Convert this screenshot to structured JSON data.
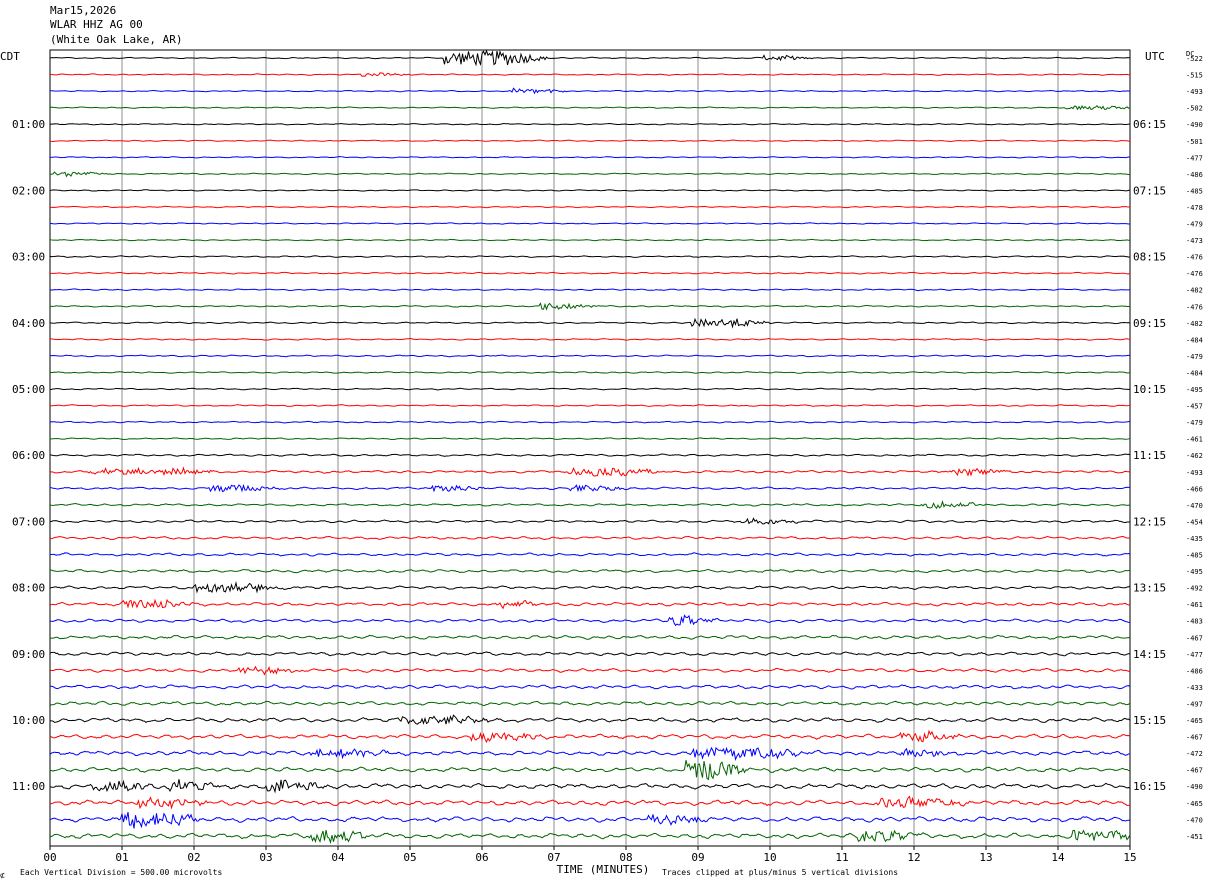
{
  "header": {
    "date": "Mar15,2026",
    "station": "WLAR HHZ AG 00",
    "location": "(White Oak Lake, AR)"
  },
  "left_timezone": "CDT",
  "right_timezone": "UTC",
  "dc_label": "DC",
  "footer": {
    "left_glyph": "⊄",
    "scale_note": "Each Vertical Division =  500.00 microvolts",
    "clip_note": "Traces clipped at plus/minus 5 vertical divisions"
  },
  "chart_data": {
    "type": "line",
    "title": "",
    "xlabel": "TIME (MINUTES)",
    "ylabel": "",
    "xlim": [
      0,
      15
    ],
    "x_ticks": [
      "00",
      "01",
      "02",
      "03",
      "04",
      "05",
      "06",
      "07",
      "08",
      "09",
      "10",
      "11",
      "12",
      "13",
      "14",
      "15"
    ],
    "grid": true,
    "series_colors": [
      "#000000",
      "#ff0000",
      "#0000ff",
      "#006400"
    ],
    "left_hour_labels": [
      "01:00",
      "02:00",
      "03:00",
      "04:00",
      "05:00",
      "06:00",
      "07:00",
      "08:00",
      "09:00",
      "10:00",
      "11:00"
    ],
    "right_hour_labels": [
      "06:15",
      "07:15",
      "08:15",
      "09:15",
      "10:15",
      "11:15",
      "12:15",
      "13:15",
      "14:15",
      "15:15",
      "16:15"
    ],
    "dc_offsets": [
      -522,
      -515,
      -493,
      -502,
      -490,
      -501,
      -477,
      -486,
      -485,
      -478,
      -479,
      -473,
      -476,
      -476,
      -482,
      -476,
      -482,
      -484,
      -479,
      -484,
      -495,
      -457,
      -479,
      -461,
      -462,
      -493,
      -466,
      -470,
      -454,
      -435,
      -485,
      -495,
      -492,
      -461,
      -483,
      -467,
      -477,
      -486,
      -433,
      -497,
      -465,
      -467,
      -472,
      -467,
      -490,
      -465,
      -470,
      -451
    ],
    "trace_count": 48,
    "minutes_per_trace": 15,
    "noise_level": [
      0.25,
      0.25,
      0.25,
      0.25,
      0.25,
      0.25,
      0.25,
      0.25,
      0.25,
      0.25,
      0.25,
      0.25,
      0.3,
      0.3,
      0.3,
      0.3,
      0.3,
      0.3,
      0.3,
      0.3,
      0.3,
      0.3,
      0.3,
      0.3,
      0.4,
      0.5,
      0.45,
      0.45,
      0.5,
      0.55,
      0.55,
      0.6,
      0.6,
      0.65,
      0.65,
      0.7,
      0.7,
      0.7,
      0.75,
      0.75,
      0.85,
      0.85,
      0.9,
      0.9,
      1.0,
      1.0,
      1.0,
      1.0
    ],
    "events": [
      {
        "trace": 0,
        "start_min": 5.45,
        "end_min": 6.4,
        "amplitude": 2.2
      },
      {
        "trace": 0,
        "start_min": 9.9,
        "end_min": 10.1,
        "amplitude": 0.8
      },
      {
        "trace": 1,
        "start_min": 4.3,
        "end_min": 4.5,
        "amplitude": 0.7
      },
      {
        "trace": 2,
        "start_min": 6.4,
        "end_min": 6.8,
        "amplitude": 0.7
      },
      {
        "trace": 3,
        "start_min": 14.1,
        "end_min": 14.6,
        "amplitude": 0.6
      },
      {
        "trace": 7,
        "start_min": 0.05,
        "end_min": 0.3,
        "amplitude": 0.7
      },
      {
        "trace": 15,
        "start_min": 6.8,
        "end_min": 7.1,
        "amplitude": 1.0
      },
      {
        "trace": 16,
        "start_min": 8.9,
        "end_min": 9.5,
        "amplitude": 1.3
      },
      {
        "trace": 25,
        "start_min": 0.5,
        "end_min": 1.8,
        "amplitude": 1.0
      },
      {
        "trace": 25,
        "start_min": 7.2,
        "end_min": 8.0,
        "amplitude": 1.1
      },
      {
        "trace": 25,
        "start_min": 12.5,
        "end_min": 12.8,
        "amplitude": 1.0
      },
      {
        "trace": 26,
        "start_min": 2.2,
        "end_min": 2.7,
        "amplitude": 1.0
      },
      {
        "trace": 26,
        "start_min": 5.3,
        "end_min": 5.6,
        "amplitude": 1.0
      },
      {
        "trace": 26,
        "start_min": 7.2,
        "end_min": 7.5,
        "amplitude": 1.0
      },
      {
        "trace": 27,
        "start_min": 12.1,
        "end_min": 12.5,
        "amplitude": 1.0
      },
      {
        "trace": 28,
        "start_min": 9.6,
        "end_min": 10.0,
        "amplitude": 0.9
      },
      {
        "trace": 32,
        "start_min": 2.0,
        "end_min": 2.8,
        "amplitude": 1.2
      },
      {
        "trace": 33,
        "start_min": 1.0,
        "end_min": 1.6,
        "amplitude": 1.4
      },
      {
        "trace": 33,
        "start_min": 6.2,
        "end_min": 6.4,
        "amplitude": 1.0
      },
      {
        "trace": 34,
        "start_min": 8.6,
        "end_min": 8.8,
        "amplitude": 1.5
      },
      {
        "trace": 37,
        "start_min": 2.6,
        "end_min": 3.0,
        "amplitude": 1.0
      },
      {
        "trace": 40,
        "start_min": 4.8,
        "end_min": 5.6,
        "amplitude": 1.3
      },
      {
        "trace": 41,
        "start_min": 5.8,
        "end_min": 6.4,
        "amplitude": 1.2
      },
      {
        "trace": 41,
        "start_min": 11.8,
        "end_min": 12.2,
        "amplitude": 1.4
      },
      {
        "trace": 42,
        "start_min": 3.6,
        "end_min": 4.2,
        "amplitude": 1.2
      },
      {
        "trace": 42,
        "start_min": 8.9,
        "end_min": 10.0,
        "amplitude": 1.5
      },
      {
        "trace": 42,
        "start_min": 11.8,
        "end_min": 12.1,
        "amplitude": 1.3
      },
      {
        "trace": 43,
        "start_min": 8.8,
        "end_min": 9.2,
        "amplitude": 3.0
      },
      {
        "trace": 44,
        "start_min": 0.6,
        "end_min": 0.9,
        "amplitude": 2.2
      },
      {
        "trace": 44,
        "start_min": 1.6,
        "end_min": 1.9,
        "amplitude": 1.6
      },
      {
        "trace": 44,
        "start_min": 3.0,
        "end_min": 3.4,
        "amplitude": 1.6
      },
      {
        "trace": 45,
        "start_min": 1.2,
        "end_min": 1.7,
        "amplitude": 1.4
      },
      {
        "trace": 45,
        "start_min": 11.5,
        "end_min": 12.3,
        "amplitude": 1.4
      },
      {
        "trace": 46,
        "start_min": 1.0,
        "end_min": 1.6,
        "amplitude": 2.4
      },
      {
        "trace": 46,
        "start_min": 8.3,
        "end_min": 8.7,
        "amplitude": 1.4
      },
      {
        "trace": 47,
        "start_min": 3.6,
        "end_min": 4.0,
        "amplitude": 1.8
      },
      {
        "trace": 47,
        "start_min": 11.2,
        "end_min": 11.6,
        "amplitude": 1.6
      },
      {
        "trace": 47,
        "start_min": 14.2,
        "end_min": 14.7,
        "amplitude": 1.6
      }
    ]
  }
}
